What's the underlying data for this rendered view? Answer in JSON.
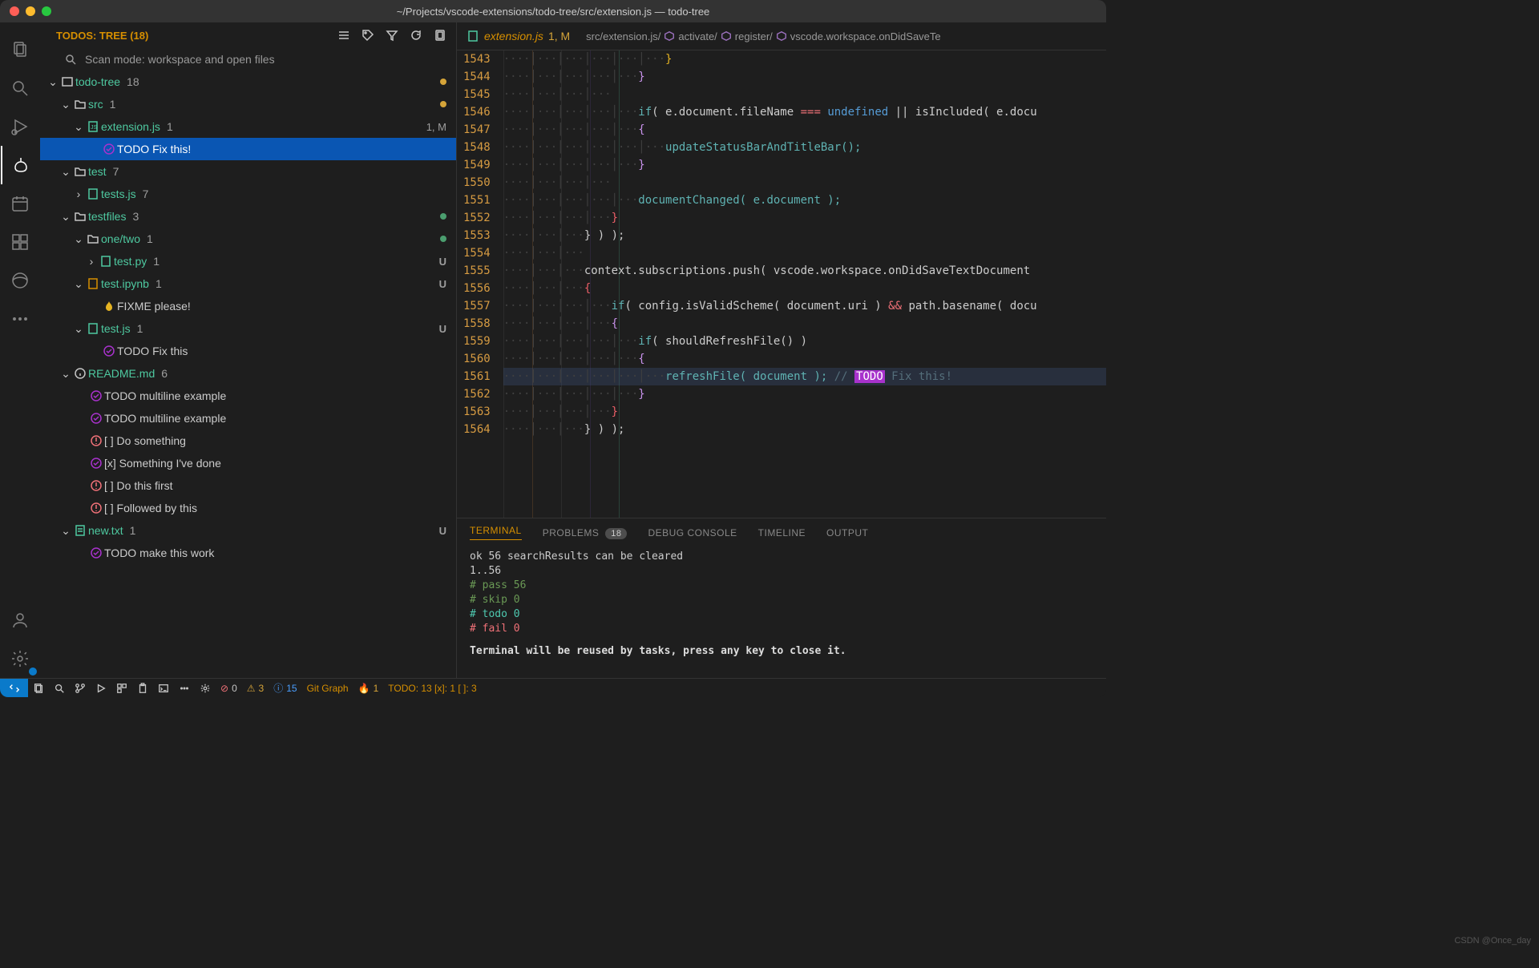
{
  "window_title": "~/Projects/vscode-extensions/todo-tree/src/extension.js — todo-tree",
  "sidebar": {
    "header_title": "TODOS: TREE (18)",
    "scan_mode": "Scan mode: workspace and open files"
  },
  "tree": {
    "root": {
      "label": "todo-tree",
      "count": "18"
    },
    "src": {
      "label": "src",
      "count": "1"
    },
    "extjs": {
      "label": "extension.js",
      "count": "1",
      "badge": "1, M"
    },
    "todo_fix": "TODO Fix this!",
    "test": {
      "label": "test",
      "count": "7"
    },
    "testsjs": {
      "label": "tests.js",
      "count": "7"
    },
    "testfiles": {
      "label": "testfiles",
      "count": "3"
    },
    "onetwo": {
      "label": "one/two",
      "count": "1"
    },
    "testpy": {
      "label": "test.py",
      "count": "1",
      "badge": "U"
    },
    "testipynb": {
      "label": "test.ipynb",
      "count": "1",
      "badge": "U"
    },
    "fixme": "FIXME please!",
    "testjs2": {
      "label": "test.js",
      "count": "1",
      "badge": "U"
    },
    "todo_fix2": "TODO Fix this",
    "readme": {
      "label": "README.md",
      "count": "6"
    },
    "todo_ml1": "TODO multiline example",
    "todo_ml2": "TODO multiline example",
    "do_something": "[ ] Do something",
    "something_done": "[x] Something I've done",
    "do_first": "[ ] Do this first",
    "followed": "[ ] Followed by this",
    "newtxt": {
      "label": "new.txt",
      "count": "1",
      "badge": "U"
    },
    "todo_work": "TODO make this work"
  },
  "tab": {
    "file": "extension.js",
    "badge": "1, M"
  },
  "breadcrumb": {
    "b1": "src/extension.js/",
    "b2": "activate/",
    "b3": "register/",
    "b4": "vscode.workspace.onDidSaveTe"
  },
  "code": {
    "lines": [
      "1543",
      "1544",
      "1545",
      "1546",
      "1547",
      "1548",
      "1549",
      "1550",
      "1551",
      "1552",
      "1553",
      "1554",
      "1555",
      "1556",
      "1557",
      "1558",
      "1559",
      "1560",
      "1561",
      "1562",
      "1563",
      "1564"
    ]
  },
  "line1543": "}",
  "line1544": "}",
  "line1546a": "if",
  "line1546b": "( e.document.fileName ",
  "line1546c": "===",
  "line1546d": " ",
  "line1546e": "undefined",
  "line1546f": " || isIncluded( e.docu",
  "line1547": "{",
  "line1548": "updateStatusBarAndTitleBar();",
  "line1549": "}",
  "line1551": "documentChanged( e.document );",
  "line1552": "}",
  "line1553": "} ) );",
  "line1555": "context.subscriptions.push( vscode.workspace.onDidSaveTextDocument",
  "line1556": "{",
  "line1557a": "if",
  "line1557b": "( config.isValidScheme( document.uri ) ",
  "line1557c": "&&",
  "line1557d": " path.basename( docu",
  "line1558": "{",
  "line1559a": "if",
  "line1559b": "( shouldRefreshFile() )",
  "line1560": "{",
  "line1561a": "refreshFile( document ); ",
  "line1561b": "// ",
  "line1561c": "TODO",
  "line1561d": " Fix this!",
  "line1562": "}",
  "line1563": "}",
  "line1564": "} ) );",
  "panel": {
    "tabs": {
      "terminal": "TERMINAL",
      "problems": "PROBLEMS",
      "problems_badge": "18",
      "debug": "DEBUG CONSOLE",
      "timeline": "TIMELINE",
      "output": "OUTPUT"
    },
    "l1": "ok 56 searchResults can be cleared",
    "l2": "1..56",
    "l3": "# pass 56",
    "l4": "# skip 0",
    "l5": "# todo 0",
    "l6": "# fail 0",
    "l7": "Terminal will be reused by tasks, press any key to close it."
  },
  "statusbar": {
    "err": "0",
    "warn": "3",
    "info": "15",
    "gitgraph": "Git Graph",
    "fire": "1",
    "todo": "TODO: 13  [x]: 1  [ ]: 3"
  },
  "watermark": "CSDN @Once_day"
}
